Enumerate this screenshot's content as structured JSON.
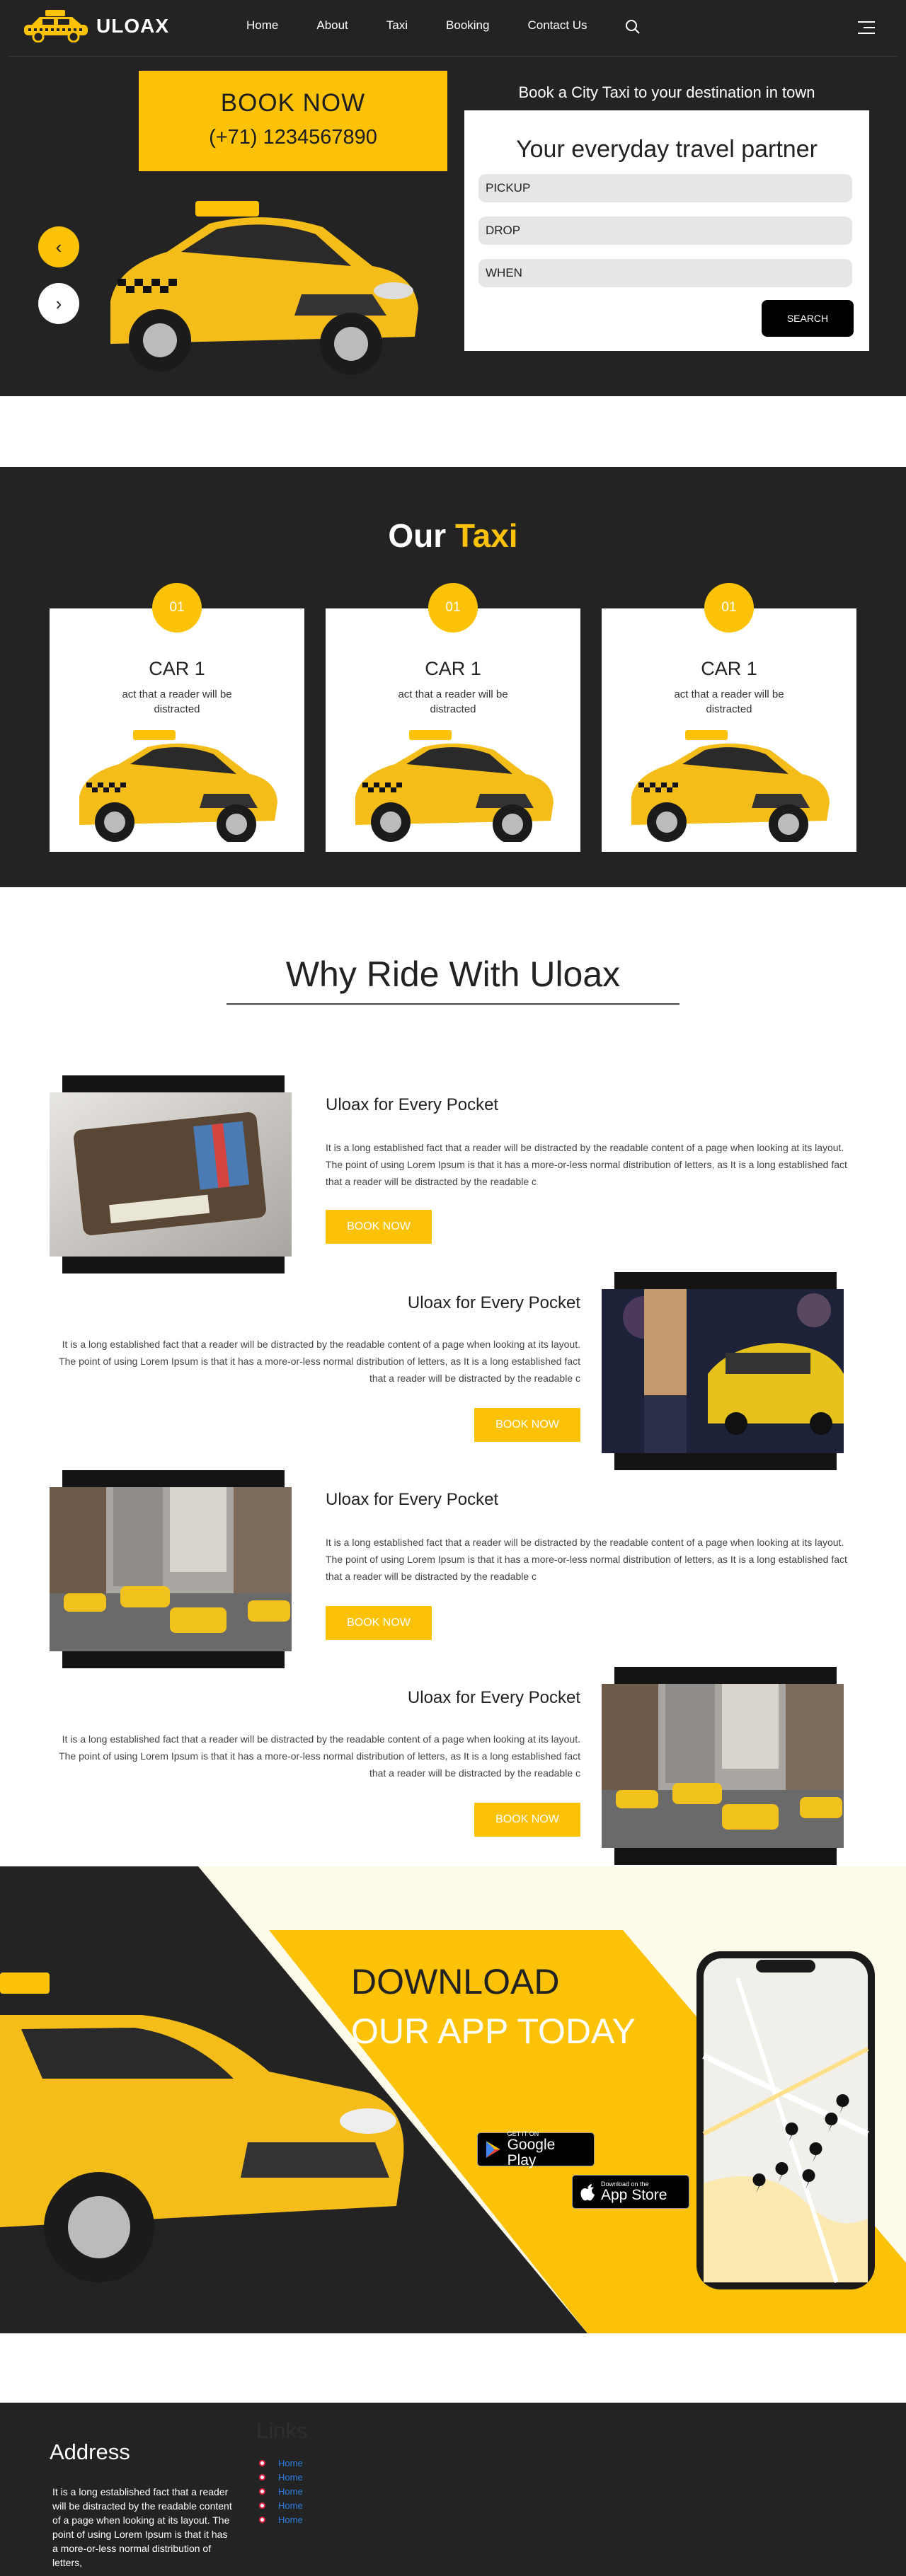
{
  "header": {
    "logo_text": "ULOAX",
    "nav": [
      "Home",
      "About",
      "Taxi",
      "Booking",
      "Contact Us"
    ],
    "book_now": "BOOK NOW",
    "phone": "(+71) 1234567890",
    "form_caption": "Book a City Taxi to your destination in town",
    "form_heading": "Your everyday travel partner",
    "pickup_placeholder": "PICKUP",
    "drop_placeholder": "DROP",
    "when_placeholder": "WHEN",
    "search_label": "SEARCH",
    "prev_arrow": "‹",
    "next_arrow": "›"
  },
  "taxi": {
    "title_white": "Our",
    "title_yellow": "Taxi",
    "cards": [
      {
        "number": "01",
        "title": "CAR 1",
        "text": "act that a reader will be distracted"
      },
      {
        "number": "01",
        "title": "CAR 1",
        "text": "act that a reader will be distracted"
      },
      {
        "number": "01",
        "title": "CAR 1",
        "text": "act that a reader will be distracted"
      }
    ]
  },
  "why": {
    "title": "Why Ride With Uloax",
    "rows": [
      {
        "title": "Uloax for Every Pocket",
        "text": "It is a long established fact that a reader will be distracted by the readable content of a page when looking at its layout. The point of using Lorem Ipsum is that it has a more-or-less normal distribution of letters, as It is a long established fact that a reader will be distracted by the readable c",
        "button": "BOOK NOW"
      },
      {
        "title": "Uloax for Every Pocket",
        "text": "It is a long established fact that a reader will be distracted by the readable content of a page when looking at its layout. The point of using Lorem Ipsum is that it has a more-or-less normal distribution of letters, as It is a long established fact that a reader will be distracted by the readable c",
        "button": "BOOK NOW"
      },
      {
        "title": "Uloax for Every Pocket",
        "text": "It is a long established fact that a reader will be distracted by the readable content of a page when looking at its layout. The point of using Lorem Ipsum is that it has a more-or-less normal distribution of letters, as It is a long established fact that a reader will be distracted by the readable c",
        "button": "BOOK NOW"
      },
      {
        "title": "Uloax for Every Pocket",
        "text": "It is a long established fact that a reader will be distracted by the readable content of a page when looking at its layout. The point of using Lorem Ipsum is that it has a more-or-less normal distribution of letters, as It is a long established fact that a reader will be distracted by the readable c",
        "button": "BOOK NOW"
      }
    ]
  },
  "download": {
    "line1": "DOWNLOAD",
    "line2": "OUR APP TODAY",
    "google_small": "GET IT ON",
    "google_big": "Google Play",
    "apple_small": "Download on the",
    "apple_big": "App Store"
  },
  "footer": {
    "address_title": "Address",
    "address_text": "It is a long established fact that a reader will be distracted by the readable content of a page when looking at its layout. The point of using Lorem Ipsum is that it has a more-or-less normal distribution of letters,",
    "links_title": "Links",
    "links": [
      "Home",
      "Home",
      "Home",
      "Home",
      "Home"
    ]
  },
  "colors": {
    "accent": "#fcc208",
    "dark": "#232323",
    "cream": "#fffbeb"
  }
}
